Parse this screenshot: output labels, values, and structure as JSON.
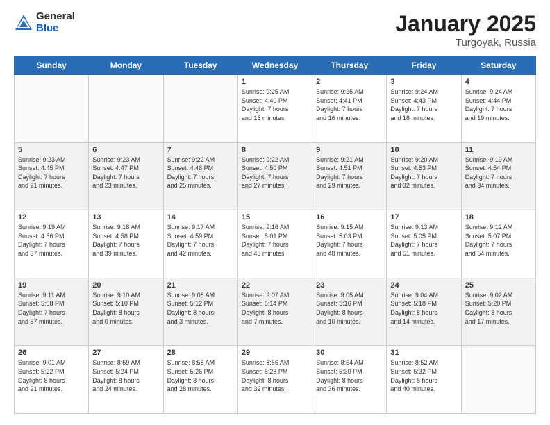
{
  "header": {
    "logo_general": "General",
    "logo_blue": "Blue",
    "month_year": "January 2025",
    "location": "Turgoyak, Russia"
  },
  "days_of_week": [
    "Sunday",
    "Monday",
    "Tuesday",
    "Wednesday",
    "Thursday",
    "Friday",
    "Saturday"
  ],
  "rows": [
    [
      {
        "day": "",
        "info": ""
      },
      {
        "day": "",
        "info": ""
      },
      {
        "day": "",
        "info": ""
      },
      {
        "day": "1",
        "info": "Sunrise: 9:25 AM\nSunset: 4:40 PM\nDaylight: 7 hours\nand 15 minutes."
      },
      {
        "day": "2",
        "info": "Sunrise: 9:25 AM\nSunset: 4:41 PM\nDaylight: 7 hours\nand 16 minutes."
      },
      {
        "day": "3",
        "info": "Sunrise: 9:24 AM\nSunset: 4:43 PM\nDaylight: 7 hours\nand 18 minutes."
      },
      {
        "day": "4",
        "info": "Sunrise: 9:24 AM\nSunset: 4:44 PM\nDaylight: 7 hours\nand 19 minutes."
      }
    ],
    [
      {
        "day": "5",
        "info": "Sunrise: 9:23 AM\nSunset: 4:45 PM\nDaylight: 7 hours\nand 21 minutes."
      },
      {
        "day": "6",
        "info": "Sunrise: 9:23 AM\nSunset: 4:47 PM\nDaylight: 7 hours\nand 23 minutes."
      },
      {
        "day": "7",
        "info": "Sunrise: 9:22 AM\nSunset: 4:48 PM\nDaylight: 7 hours\nand 25 minutes."
      },
      {
        "day": "8",
        "info": "Sunrise: 9:22 AM\nSunset: 4:50 PM\nDaylight: 7 hours\nand 27 minutes."
      },
      {
        "day": "9",
        "info": "Sunrise: 9:21 AM\nSunset: 4:51 PM\nDaylight: 7 hours\nand 29 minutes."
      },
      {
        "day": "10",
        "info": "Sunrise: 9:20 AM\nSunset: 4:53 PM\nDaylight: 7 hours\nand 32 minutes."
      },
      {
        "day": "11",
        "info": "Sunrise: 9:19 AM\nSunset: 4:54 PM\nDaylight: 7 hours\nand 34 minutes."
      }
    ],
    [
      {
        "day": "12",
        "info": "Sunrise: 9:19 AM\nSunset: 4:56 PM\nDaylight: 7 hours\nand 37 minutes."
      },
      {
        "day": "13",
        "info": "Sunrise: 9:18 AM\nSunset: 4:58 PM\nDaylight: 7 hours\nand 39 minutes."
      },
      {
        "day": "14",
        "info": "Sunrise: 9:17 AM\nSunset: 4:59 PM\nDaylight: 7 hours\nand 42 minutes."
      },
      {
        "day": "15",
        "info": "Sunrise: 9:16 AM\nSunset: 5:01 PM\nDaylight: 7 hours\nand 45 minutes."
      },
      {
        "day": "16",
        "info": "Sunrise: 9:15 AM\nSunset: 5:03 PM\nDaylight: 7 hours\nand 48 minutes."
      },
      {
        "day": "17",
        "info": "Sunrise: 9:13 AM\nSunset: 5:05 PM\nDaylight: 7 hours\nand 51 minutes."
      },
      {
        "day": "18",
        "info": "Sunrise: 9:12 AM\nSunset: 5:07 PM\nDaylight: 7 hours\nand 54 minutes."
      }
    ],
    [
      {
        "day": "19",
        "info": "Sunrise: 9:11 AM\nSunset: 5:08 PM\nDaylight: 7 hours\nand 57 minutes."
      },
      {
        "day": "20",
        "info": "Sunrise: 9:10 AM\nSunset: 5:10 PM\nDaylight: 8 hours\nand 0 minutes."
      },
      {
        "day": "21",
        "info": "Sunrise: 9:08 AM\nSunset: 5:12 PM\nDaylight: 8 hours\nand 3 minutes."
      },
      {
        "day": "22",
        "info": "Sunrise: 9:07 AM\nSunset: 5:14 PM\nDaylight: 8 hours\nand 7 minutes."
      },
      {
        "day": "23",
        "info": "Sunrise: 9:05 AM\nSunset: 5:16 PM\nDaylight: 8 hours\nand 10 minutes."
      },
      {
        "day": "24",
        "info": "Sunrise: 9:04 AM\nSunset: 5:18 PM\nDaylight: 8 hours\nand 14 minutes."
      },
      {
        "day": "25",
        "info": "Sunrise: 9:02 AM\nSunset: 5:20 PM\nDaylight: 8 hours\nand 17 minutes."
      }
    ],
    [
      {
        "day": "26",
        "info": "Sunrise: 9:01 AM\nSunset: 5:22 PM\nDaylight: 8 hours\nand 21 minutes."
      },
      {
        "day": "27",
        "info": "Sunrise: 8:59 AM\nSunset: 5:24 PM\nDaylight: 8 hours\nand 24 minutes."
      },
      {
        "day": "28",
        "info": "Sunrise: 8:58 AM\nSunset: 5:26 PM\nDaylight: 8 hours\nand 28 minutes."
      },
      {
        "day": "29",
        "info": "Sunrise: 8:56 AM\nSunset: 5:28 PM\nDaylight: 8 hours\nand 32 minutes."
      },
      {
        "day": "30",
        "info": "Sunrise: 8:54 AM\nSunset: 5:30 PM\nDaylight: 8 hours\nand 36 minutes."
      },
      {
        "day": "31",
        "info": "Sunrise: 8:52 AM\nSunset: 5:32 PM\nDaylight: 8 hours\nand 40 minutes."
      },
      {
        "day": "",
        "info": ""
      }
    ]
  ]
}
